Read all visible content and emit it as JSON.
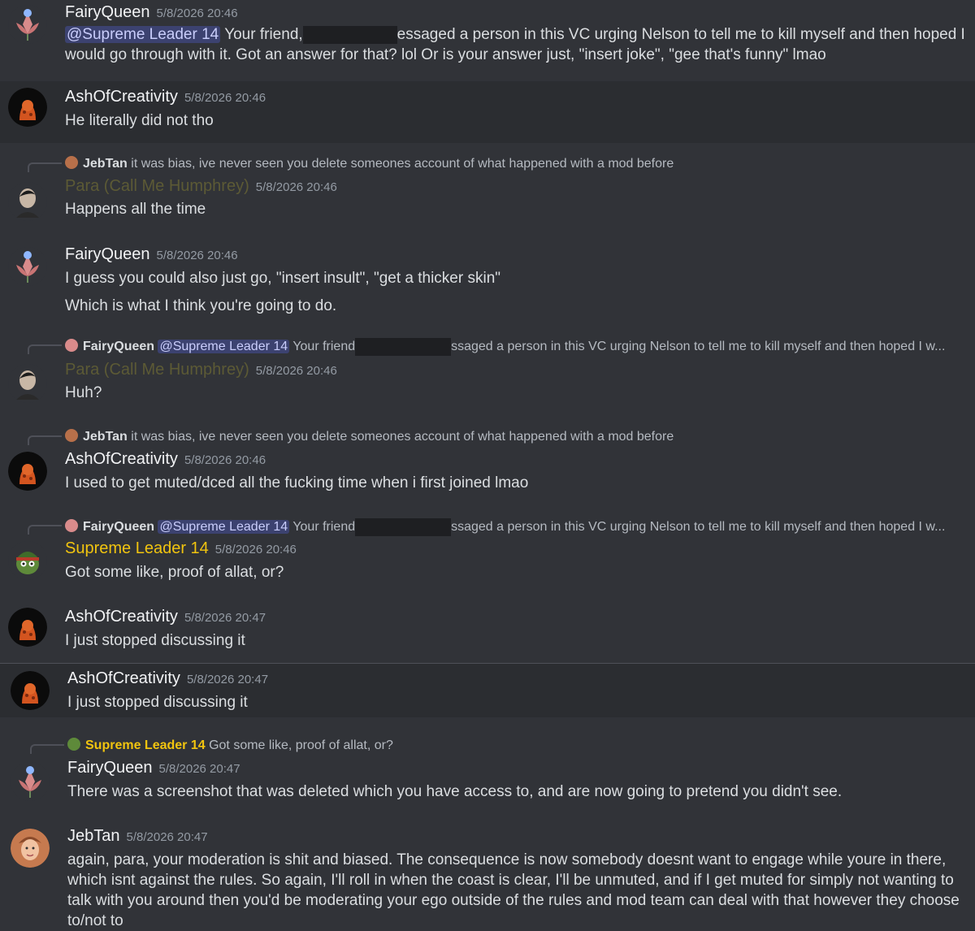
{
  "colors": {
    "bg": "#313338",
    "highlight": "#2b2d31",
    "para": "#5c5a35",
    "supreme": "#f1c40f",
    "mention_bg": "#3c4270"
  },
  "messages": [
    {
      "author": "FairyQueen",
      "time": "5/8/2026 20:46",
      "mention": "@Supreme Leader 14",
      "pre": "Your friend,",
      "post": "essaged a person in this VC urging Nelson to tell me to kill myself and then hoped I",
      "line2": "would go through with it. Got an answer for that? lol Or is your answer just, \"insert joke\", \"gee that's funny\" lmao"
    },
    {
      "author": "AshOfCreativity",
      "time": "5/8/2026 20:46",
      "text": "He literally did not tho"
    },
    {
      "reply_name": "JebTan",
      "reply_text": "it was bias, ive never seen you delete someones account of what happened with a mod before",
      "author": "Para (Call Me Humphrey)",
      "time": "5/8/2026 20:46",
      "text": "Happens all the time"
    },
    {
      "author": "FairyQueen",
      "time": "5/8/2026 20:46",
      "text": "I guess you could also just go, \"insert insult\", \"get a thicker skin\"",
      "text2": "Which is what I think you're going to do."
    },
    {
      "reply_name": "FairyQueen",
      "reply_mention": "@Supreme Leader 14",
      "reply_pre": "Your friend",
      "reply_post": "ssaged a person in this VC urging Nelson to tell me to kill myself and then hoped I w...",
      "author": "Para (Call Me Humphrey)",
      "time": "5/8/2026 20:46",
      "text": "Huh?"
    },
    {
      "reply_name": "JebTan",
      "reply_text": "it was bias, ive never seen you delete someones account of what happened with a mod before",
      "author": "AshOfCreativity",
      "time": "5/8/2026 20:46",
      "text": "I used to get muted/dced all the fucking time when i first joined lmao"
    },
    {
      "reply_name": "FairyQueen",
      "reply_mention": "@Supreme Leader 14",
      "reply_pre": "Your friend",
      "reply_post": "ssaged a person in this VC urging Nelson to tell me to kill myself and then hoped I w...",
      "author": "Supreme Leader 14",
      "time": "5/8/2026 20:46",
      "text": "Got some like, proof of allat, or?"
    },
    {
      "author": "AshOfCreativity",
      "time": "5/8/2026 20:47",
      "text": "I just stopped discussing it"
    },
    {
      "author": "AshOfCreativity",
      "time": "5/8/2026 20:47",
      "text": "I just stopped discussing it"
    },
    {
      "reply_name": "Supreme Leader 14",
      "reply_text": "Got some like, proof of allat, or?",
      "author": "FairyQueen",
      "time": "5/8/2026 20:47",
      "text": "There was a screenshot that was deleted which you have access to, and are now going to pretend you didn't see."
    },
    {
      "author": "JebTan",
      "time": "5/8/2026 20:47",
      "text": "again, para, your moderation is shit and biased. The consequence is now somebody doesnt want to engage while youre in there, which isnt against the rules. So again, I'll roll in when the coast is clear, I'll be unmuted, and if I get muted for simply not wanting to talk with you around then you'd be moderating your ego outside of the rules and mod team can deal with that however they choose to/not to"
    }
  ]
}
